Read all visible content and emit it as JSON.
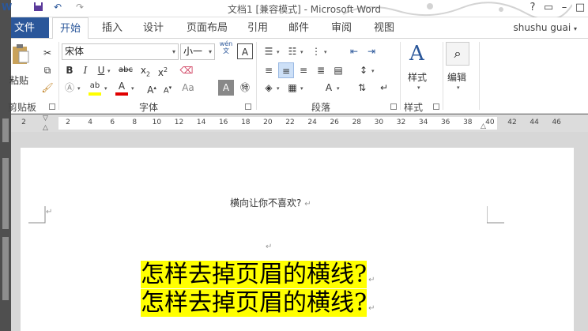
{
  "window": {
    "title": "文档1 [兼容模式] - Microsoft Word",
    "user": "shushu guai"
  },
  "tabs": [
    {
      "label": "文件"
    },
    {
      "label": "开始"
    },
    {
      "label": "插入"
    },
    {
      "label": "设计"
    },
    {
      "label": "页面布局"
    },
    {
      "label": "引用"
    },
    {
      "label": "邮件"
    },
    {
      "label": "审阅"
    },
    {
      "label": "视图"
    }
  ],
  "ribbon": {
    "clipboard": {
      "paste_label": "粘贴",
      "group_label": "剪贴板"
    },
    "font": {
      "font_name": "宋体",
      "font_size": "小一",
      "wen_glyph": "wén",
      "group_label": "字体"
    },
    "paragraph": {
      "group_label": "段落"
    },
    "styles": {
      "button_label": "样式",
      "group_label": "样式"
    },
    "editing": {
      "button_label": "编辑"
    }
  },
  "ruler": {
    "numbers": [
      "2",
      "2",
      "4",
      "6",
      "8",
      "10",
      "12",
      "14",
      "16",
      "18",
      "20",
      "22",
      "24",
      "26",
      "28",
      "30",
      "32",
      "34",
      "36",
      "38",
      "40",
      "42",
      "44",
      "46"
    ]
  },
  "document": {
    "header_text": "横向让你不喜欢?",
    "paragraph_mark": "↵",
    "lines": [
      "怎样去掉页眉的横线?",
      "怎样去掉页眉的横线?"
    ]
  },
  "colors": {
    "accent": "#2b579a",
    "highlight": "#ffff00",
    "font_color_bar": "#e00000",
    "highlight_bar": "#ffff00"
  }
}
